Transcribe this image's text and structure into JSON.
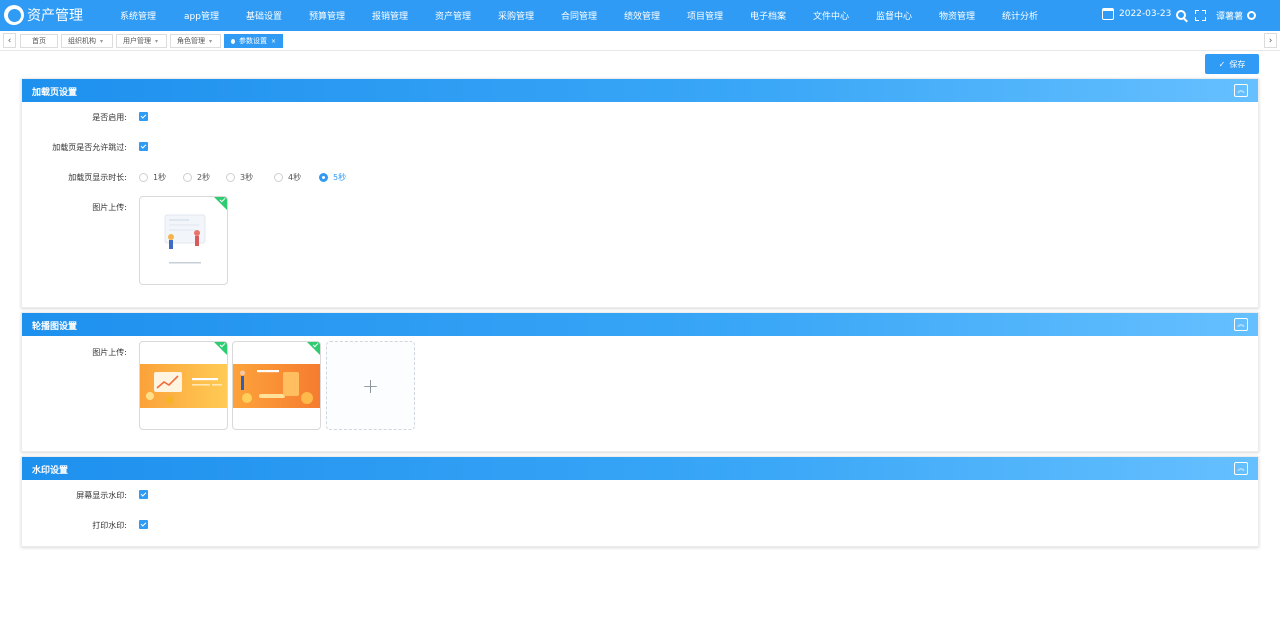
{
  "app": {
    "title": "资产管理"
  },
  "nav": {
    "items": [
      "系统管理",
      "app管理",
      "基础设置",
      "预算管理",
      "报销管理",
      "资产管理",
      "采购管理",
      "合同管理",
      "绩效管理",
      "项目管理",
      "电子档案",
      "文件中心",
      "监督中心",
      "物资管理",
      "统计分析"
    ],
    "date": "2022-03-23",
    "user": "谭薯薯"
  },
  "tabs": {
    "items": [
      {
        "label": "首页",
        "active": false,
        "dropdown": false
      },
      {
        "label": "组织机构",
        "active": false,
        "dropdown": true
      },
      {
        "label": "用户管理",
        "active": false,
        "dropdown": true
      },
      {
        "label": "角色管理",
        "active": false,
        "dropdown": true
      },
      {
        "label": "参数设置",
        "active": true,
        "closable": true
      }
    ],
    "close_glyph": "×",
    "caret_glyph": "▾"
  },
  "toolbar": {
    "save_label": "保存"
  },
  "panels": {
    "loading": {
      "title": "加载页设置",
      "enabled_label": "是否启用:",
      "enabled": true,
      "skip_label": "加载页是否允许跳过:",
      "skip": true,
      "duration_label": "加载页显示时长:",
      "duration_options": [
        "1秒",
        "2秒",
        "3秒",
        "4秒",
        "5秒"
      ],
      "duration_selected": "5秒",
      "image_label": "图片上传:"
    },
    "carousel": {
      "title": "轮播图设置",
      "image_label": "图片上传:",
      "add_glyph": "+"
    },
    "watermark": {
      "title": "水印设置",
      "screen_label": "屏幕显示水印:",
      "screen": true,
      "print_label": "打印水印:",
      "print": true
    }
  },
  "colors": {
    "primary": "#2f9bf5",
    "success": "#2ecc71",
    "banner_orange": "#fba23a"
  },
  "icons": [
    "calendar-icon",
    "search-icon",
    "fullscreen-icon",
    "gear-icon",
    "check-icon",
    "collapse-up-icon",
    "plus-icon"
  ]
}
